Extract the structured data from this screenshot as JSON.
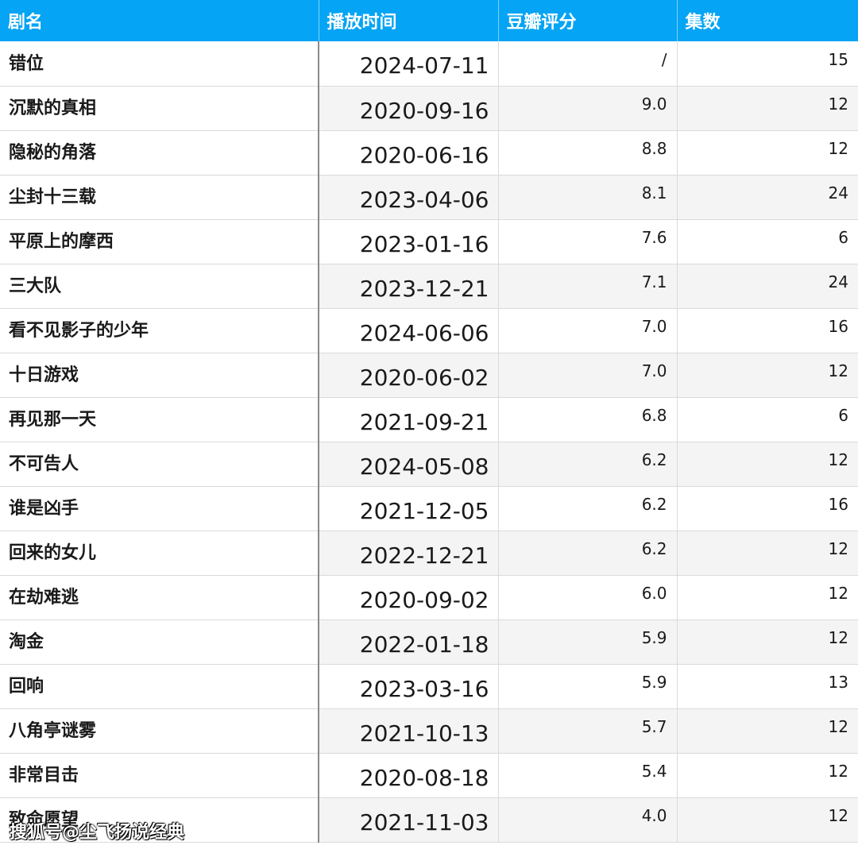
{
  "table": {
    "headers": [
      "剧名",
      "播放时间",
      "豆瓣评分",
      "集数"
    ],
    "rows": [
      {
        "name": "错位",
        "date": "2024-07-11",
        "score": "/",
        "episodes": "15"
      },
      {
        "name": "沉默的真相",
        "date": "2020-09-16",
        "score": "9.0",
        "episodes": "12"
      },
      {
        "name": "隐秘的角落",
        "date": "2020-06-16",
        "score": "8.8",
        "episodes": "12"
      },
      {
        "name": "尘封十三载",
        "date": "2023-04-06",
        "score": "8.1",
        "episodes": "24"
      },
      {
        "name": "平原上的摩西",
        "date": "2023-01-16",
        "score": "7.6",
        "episodes": "6"
      },
      {
        "name": "三大队",
        "date": "2023-12-21",
        "score": "7.1",
        "episodes": "24"
      },
      {
        "name": "看不见影子的少年",
        "date": "2024-06-06",
        "score": "7.0",
        "episodes": "16"
      },
      {
        "name": "十日游戏",
        "date": "2020-06-02",
        "score": "7.0",
        "episodes": "12"
      },
      {
        "name": "再见那一天",
        "date": "2021-09-21",
        "score": "6.8",
        "episodes": "6"
      },
      {
        "name": "不可告人",
        "date": "2024-05-08",
        "score": "6.2",
        "episodes": "12"
      },
      {
        "name": "谁是凶手",
        "date": "2021-12-05",
        "score": "6.2",
        "episodes": "16"
      },
      {
        "name": "回来的女儿",
        "date": "2022-12-21",
        "score": "6.2",
        "episodes": "12"
      },
      {
        "name": "在劫难逃",
        "date": "2020-09-02",
        "score": "6.0",
        "episodes": "12"
      },
      {
        "name": "淘金",
        "date": "2022-01-18",
        "score": "5.9",
        "episodes": "12"
      },
      {
        "name": "回响",
        "date": "2023-03-16",
        "score": "5.9",
        "episodes": "13"
      },
      {
        "name": "八角亭谜雾",
        "date": "2021-10-13",
        "score": "5.7",
        "episodes": "12"
      },
      {
        "name": "非常目击",
        "date": "2020-08-18",
        "score": "5.4",
        "episodes": "12"
      },
      {
        "name": "致命愿望",
        "date": "2021-11-03",
        "score": "4.0",
        "episodes": "12"
      }
    ]
  },
  "watermark": "搜狐号@尘飞扬说经典",
  "colors": {
    "header_bg": "#05a4f4",
    "header_text": "#ffffff",
    "alt_row_bg": "#f4f4f4"
  }
}
